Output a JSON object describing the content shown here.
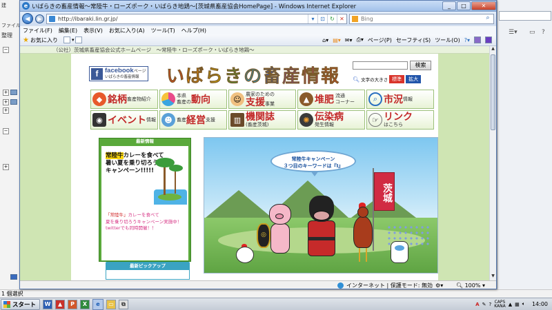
{
  "ie": {
    "title": "いばらきの畜産情報～常陸牛・ローズポーク・いばらき地鶏～[茨城県畜産協会HomePage] - Windows Internet Explorer",
    "url": "http://ibaraki.lin.gr.jp/",
    "search_placeholder": "Bing",
    "menu": [
      "ファイル(F)",
      "編集(E)",
      "表示(V)",
      "お気に入り(A)",
      "ツール(T)",
      "ヘルプ(H)"
    ],
    "favorites_label": "お気に入り",
    "toolbar": {
      "page": "ページ(P)",
      "safety": "セーフティ(S)",
      "tools": "ツール(O)"
    },
    "status": {
      "zone": "インターネット | 保護モード: 無効",
      "zoom": "100%"
    }
  },
  "background_window": {
    "toolbar_text": "整理",
    "menu_text": "ファイル",
    "status_text": "1 個選択"
  },
  "site": {
    "tagline": "（公社）茨城県畜産協会公式ホームページ　～常陸牛・ローズポーク・いばらき地鶏～",
    "facebook_main": "facebook",
    "facebook_sub": "ページ",
    "facebook_caption": "いばらきの畜産情報",
    "title": "いばらきの畜産情報",
    "title_colors": [
      "#e9431e",
      "#f08c00",
      "#e5b800",
      "#3ca83c",
      "#1f9ed8",
      "#3058c8",
      "#8d3cc8",
      "#d2338a",
      "#e9431e"
    ],
    "search_button": "検索",
    "font_size_label": "文字の大きさ",
    "font_standard": "標準",
    "font_large": "拡大",
    "nav": [
      {
        "big": "銘柄",
        "small": "畜産物紹介",
        "icon": "meat-icon"
      },
      {
        "pre": "本県",
        "pre2": "畜産の",
        "big": "動向",
        "icon": "pie-chart-icon"
      },
      {
        "small": "農家のための",
        "big": "支援",
        "small2": "事業",
        "icon": "worker-icon"
      },
      {
        "big": "堆肥",
        "small": "流通",
        "small2": "コーナー",
        "icon": "compost-icon"
      },
      {
        "big": "市況",
        "small": "情報",
        "icon": "magnifier-icon"
      },
      {
        "big": "イベント",
        "small": "情報",
        "icon": "camera-icon"
      },
      {
        "small": "畜産",
        "big": "経営",
        "small2": "支援",
        "icon": "farmer-icon"
      },
      {
        "big": "機関誌",
        "small": "(畜産茨城)",
        "icon": "books-icon"
      },
      {
        "big": "伝染病",
        "small": "発生情報",
        "icon": "virus-icon"
      },
      {
        "big": "リンク",
        "small": "はこちら",
        "icon": "pointing-hand-icon"
      }
    ],
    "news": {
      "heading": "最新情報",
      "image_text_1": "常陸牛",
      "image_text_2": "カレーを食べて",
      "image_text_3": "暑い夏を乗り切ろう",
      "image_text_4": "キャンペーン!!!!!",
      "caption_1": "「常陸牛」",
      "caption_2": "カレーを食べて",
      "caption_3": "夏を乗り切ろうキャンペーン実施中！",
      "caption_4": "twitterでも同時開催！！"
    },
    "pickup_heading": "最新ピックアップ",
    "hero": {
      "bubble_line1": "常陸牛キャンペーン",
      "bubble_line2": "３つ目のキーワードは『I』",
      "flag": "茨城"
    }
  },
  "taskbar": {
    "start": "スタート",
    "tray_time": "14:00",
    "tray_kb_1": "CAPS",
    "tray_kb_2": "KANA"
  }
}
